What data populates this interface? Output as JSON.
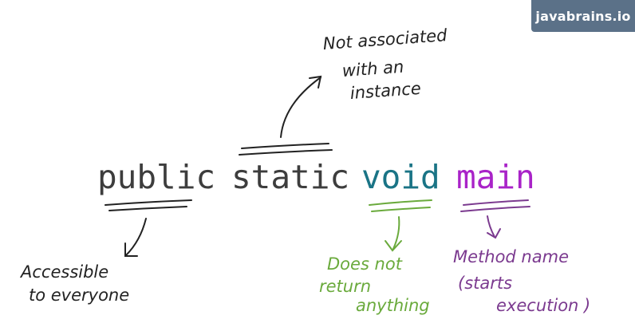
{
  "badge": {
    "text": "javabrains.io"
  },
  "code": {
    "public": "public",
    "static": "static",
    "void": "void",
    "main": "main"
  },
  "annotations": {
    "static_note": [
      "Not associated",
      "with an",
      "instance"
    ],
    "public_note": [
      "Accessible",
      "to everyone"
    ],
    "void_note": [
      "Does not",
      "return",
      "anything"
    ],
    "main_note": [
      "Method name",
      "(starts",
      "execution )"
    ]
  },
  "colors": {
    "badge_bg": "#5b7188",
    "keyword_default": "#3d3d3d",
    "keyword_void": "#1a7486",
    "keyword_main": "#a923c8",
    "ink_dark": "#222222",
    "ink_green": "#6aaa3c",
    "ink_purple": "#7b3a8f"
  }
}
